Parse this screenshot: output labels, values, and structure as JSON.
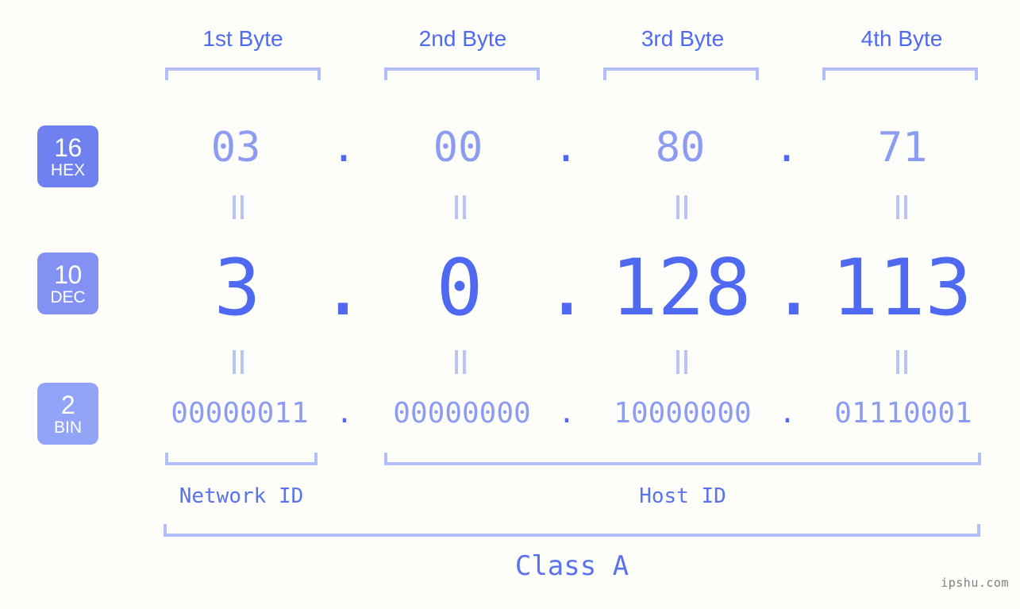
{
  "background_color": "#fdfefa",
  "colors": {
    "accent_strong": "#4f6af0",
    "accent_light": "#8d9cf2",
    "bracket": "#b3bdf7",
    "badge_hex": "#6f80ef",
    "badge_dec": "#8391f3",
    "badge_bin": "#92a4f7",
    "watermark": "#7d7d7d"
  },
  "byte_headers": [
    {
      "label": "1st Byte"
    },
    {
      "label": "2nd Byte"
    },
    {
      "label": "3rd Byte"
    },
    {
      "label": "4th Byte"
    }
  ],
  "radix_badges": [
    {
      "number": "16",
      "name": "HEX"
    },
    {
      "number": "10",
      "name": "DEC"
    },
    {
      "number": "2",
      "name": "BIN"
    }
  ],
  "separator": ".",
  "rows": {
    "hex": {
      "radix": "16",
      "name": "HEX",
      "values": [
        "03",
        "00",
        "80",
        "71"
      ]
    },
    "dec": {
      "radix": "10",
      "name": "DEC",
      "values": [
        "3",
        "0",
        "128",
        "113"
      ]
    },
    "bin": {
      "radix": "2",
      "name": "BIN",
      "values": [
        "00000011",
        "00000000",
        "10000000",
        "01110001"
      ]
    }
  },
  "id_sections": [
    {
      "label": "Network ID"
    },
    {
      "label": "Host ID"
    }
  ],
  "class": {
    "label": "Class A"
  },
  "watermark": {
    "text": "ipshu.com"
  }
}
